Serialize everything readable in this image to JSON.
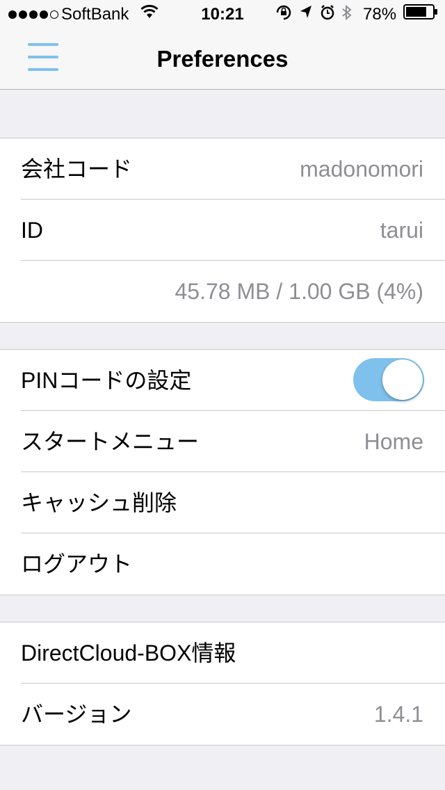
{
  "status_bar": {
    "carrier": "SoftBank",
    "time": "10:21",
    "battery_percent": "78%",
    "battery_level": 0.78,
    "signal_bars_filled": 4,
    "icons": [
      "signal-icon",
      "wifi-icon",
      "rotation-lock-icon",
      "location-arrow-icon",
      "alarm-icon",
      "bluetooth-icon",
      "battery-icon"
    ]
  },
  "nav": {
    "title": "Preferences",
    "menu_icon": "hamburger-menu-icon"
  },
  "account": {
    "company_code_label": "会社コード",
    "company_code_value": "madonomori",
    "id_label": "ID",
    "id_value": "tarui",
    "storage_usage": "45.78 MB / 1.00 GB (4%)"
  },
  "settings": {
    "pin_label": "PINコードの設定",
    "pin_enabled": true,
    "start_menu_label": "スタートメニュー",
    "start_menu_value": "Home",
    "clear_cache_label": "キャッシュ削除",
    "logout_label": "ログアウト"
  },
  "about": {
    "info_label": "DirectCloud-BOX情報",
    "version_label": "バージョン",
    "version_value": "1.4.1"
  },
  "colors": {
    "accent": "#7ec1ec",
    "background": "#efeff4",
    "secondary_text": "#8e8e93",
    "separator": "#c8c7cc"
  }
}
